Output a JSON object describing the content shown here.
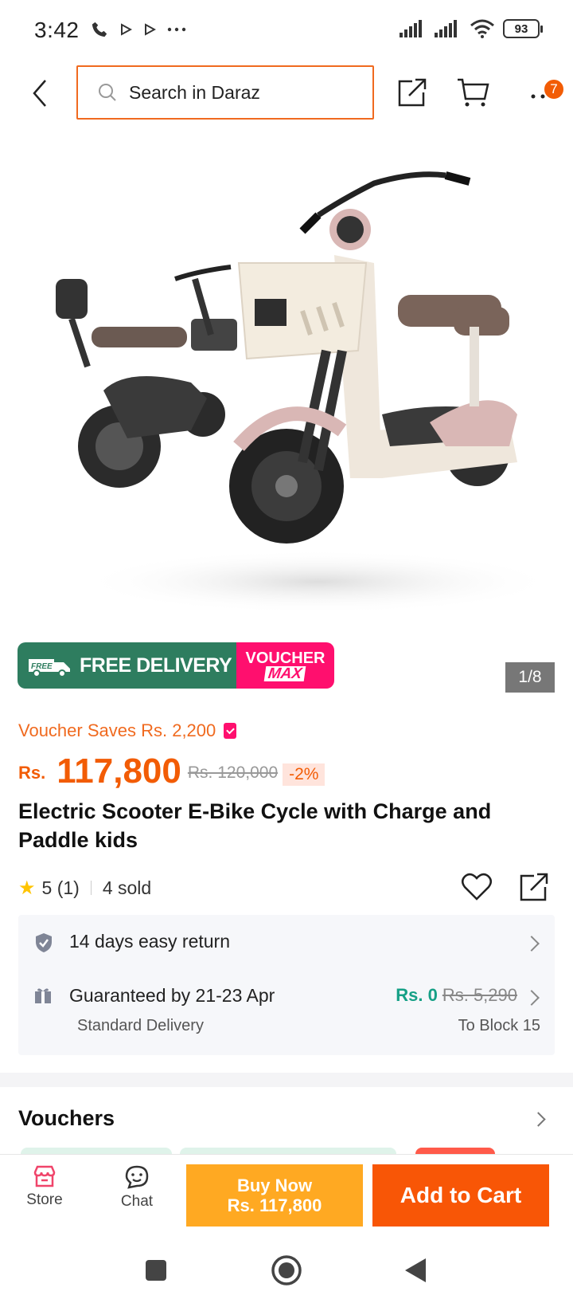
{
  "status_bar": {
    "time": "3:42",
    "battery": "93"
  },
  "nav": {
    "search_placeholder": "Search in Daraz",
    "badge_count": "7"
  },
  "product": {
    "image_counter": "1/8",
    "banner": {
      "free_tag": "FREE",
      "free_delivery": "FREE DELIVERY",
      "voucher": "VOUCHER",
      "max": "MAX"
    },
    "voucher_saves": "Voucher Saves Rs. 2,200",
    "price_currency": "Rs.",
    "price": "117,800",
    "old_price": "Rs. 120,000",
    "discount": "-2%",
    "title": "Electric Scooter E-Bike Cycle with Charge and Paddle kids",
    "rating": "5 (1)",
    "sold": "4 sold"
  },
  "service": {
    "return_text": "14 days easy return",
    "delivery_text": "Guaranteed by 21-23 Apr",
    "delivery_type": "Standard Delivery",
    "delivery_price": "Rs. 0",
    "delivery_old_price": "Rs. 5,290",
    "location": "To Block 15"
  },
  "vouchers": {
    "title": "Vouchers"
  },
  "bottom_bar": {
    "store": "Store",
    "chat": "Chat",
    "buy_now": "Buy Now",
    "buy_now_price": "Rs. 117,800",
    "add_to_cart": "Add to Cart"
  },
  "colors": {
    "brand_orange": "#f85606",
    "buy_now": "#ffa922",
    "free_green": "#2e7d5f",
    "voucher_pink": "#ff0f6e"
  }
}
